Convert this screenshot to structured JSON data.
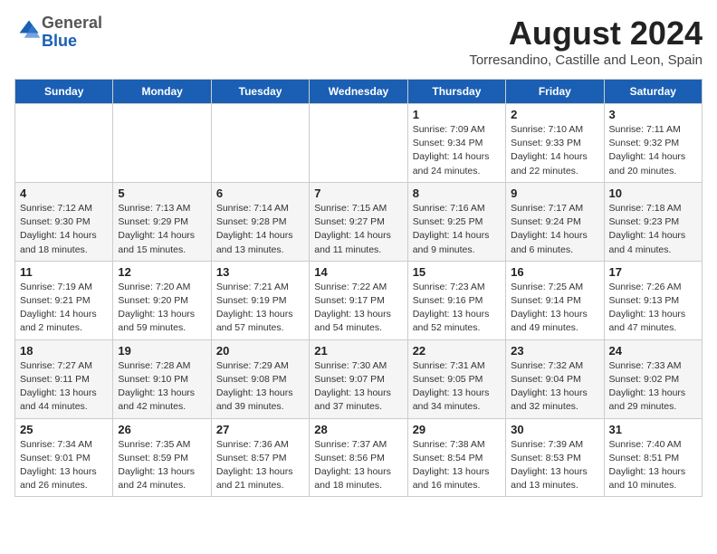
{
  "header": {
    "logo_line1": "General",
    "logo_line2": "Blue",
    "month_title": "August 2024",
    "location": "Torresandino, Castille and Leon, Spain"
  },
  "weekdays": [
    "Sunday",
    "Monday",
    "Tuesday",
    "Wednesday",
    "Thursday",
    "Friday",
    "Saturday"
  ],
  "weeks": [
    [
      {
        "day": "",
        "info": ""
      },
      {
        "day": "",
        "info": ""
      },
      {
        "day": "",
        "info": ""
      },
      {
        "day": "",
        "info": ""
      },
      {
        "day": "1",
        "info": "Sunrise: 7:09 AM\nSunset: 9:34 PM\nDaylight: 14 hours and 24 minutes."
      },
      {
        "day": "2",
        "info": "Sunrise: 7:10 AM\nSunset: 9:33 PM\nDaylight: 14 hours and 22 minutes."
      },
      {
        "day": "3",
        "info": "Sunrise: 7:11 AM\nSunset: 9:32 PM\nDaylight: 14 hours and 20 minutes."
      }
    ],
    [
      {
        "day": "4",
        "info": "Sunrise: 7:12 AM\nSunset: 9:30 PM\nDaylight: 14 hours and 18 minutes."
      },
      {
        "day": "5",
        "info": "Sunrise: 7:13 AM\nSunset: 9:29 PM\nDaylight: 14 hours and 15 minutes."
      },
      {
        "day": "6",
        "info": "Sunrise: 7:14 AM\nSunset: 9:28 PM\nDaylight: 14 hours and 13 minutes."
      },
      {
        "day": "7",
        "info": "Sunrise: 7:15 AM\nSunset: 9:27 PM\nDaylight: 14 hours and 11 minutes."
      },
      {
        "day": "8",
        "info": "Sunrise: 7:16 AM\nSunset: 9:25 PM\nDaylight: 14 hours and 9 minutes."
      },
      {
        "day": "9",
        "info": "Sunrise: 7:17 AM\nSunset: 9:24 PM\nDaylight: 14 hours and 6 minutes."
      },
      {
        "day": "10",
        "info": "Sunrise: 7:18 AM\nSunset: 9:23 PM\nDaylight: 14 hours and 4 minutes."
      }
    ],
    [
      {
        "day": "11",
        "info": "Sunrise: 7:19 AM\nSunset: 9:21 PM\nDaylight: 14 hours and 2 minutes."
      },
      {
        "day": "12",
        "info": "Sunrise: 7:20 AM\nSunset: 9:20 PM\nDaylight: 13 hours and 59 minutes."
      },
      {
        "day": "13",
        "info": "Sunrise: 7:21 AM\nSunset: 9:19 PM\nDaylight: 13 hours and 57 minutes."
      },
      {
        "day": "14",
        "info": "Sunrise: 7:22 AM\nSunset: 9:17 PM\nDaylight: 13 hours and 54 minutes."
      },
      {
        "day": "15",
        "info": "Sunrise: 7:23 AM\nSunset: 9:16 PM\nDaylight: 13 hours and 52 minutes."
      },
      {
        "day": "16",
        "info": "Sunrise: 7:25 AM\nSunset: 9:14 PM\nDaylight: 13 hours and 49 minutes."
      },
      {
        "day": "17",
        "info": "Sunrise: 7:26 AM\nSunset: 9:13 PM\nDaylight: 13 hours and 47 minutes."
      }
    ],
    [
      {
        "day": "18",
        "info": "Sunrise: 7:27 AM\nSunset: 9:11 PM\nDaylight: 13 hours and 44 minutes."
      },
      {
        "day": "19",
        "info": "Sunrise: 7:28 AM\nSunset: 9:10 PM\nDaylight: 13 hours and 42 minutes."
      },
      {
        "day": "20",
        "info": "Sunrise: 7:29 AM\nSunset: 9:08 PM\nDaylight: 13 hours and 39 minutes."
      },
      {
        "day": "21",
        "info": "Sunrise: 7:30 AM\nSunset: 9:07 PM\nDaylight: 13 hours and 37 minutes."
      },
      {
        "day": "22",
        "info": "Sunrise: 7:31 AM\nSunset: 9:05 PM\nDaylight: 13 hours and 34 minutes."
      },
      {
        "day": "23",
        "info": "Sunrise: 7:32 AM\nSunset: 9:04 PM\nDaylight: 13 hours and 32 minutes."
      },
      {
        "day": "24",
        "info": "Sunrise: 7:33 AM\nSunset: 9:02 PM\nDaylight: 13 hours and 29 minutes."
      }
    ],
    [
      {
        "day": "25",
        "info": "Sunrise: 7:34 AM\nSunset: 9:01 PM\nDaylight: 13 hours and 26 minutes."
      },
      {
        "day": "26",
        "info": "Sunrise: 7:35 AM\nSunset: 8:59 PM\nDaylight: 13 hours and 24 minutes."
      },
      {
        "day": "27",
        "info": "Sunrise: 7:36 AM\nSunset: 8:57 PM\nDaylight: 13 hours and 21 minutes."
      },
      {
        "day": "28",
        "info": "Sunrise: 7:37 AM\nSunset: 8:56 PM\nDaylight: 13 hours and 18 minutes."
      },
      {
        "day": "29",
        "info": "Sunrise: 7:38 AM\nSunset: 8:54 PM\nDaylight: 13 hours and 16 minutes."
      },
      {
        "day": "30",
        "info": "Sunrise: 7:39 AM\nSunset: 8:53 PM\nDaylight: 13 hours and 13 minutes."
      },
      {
        "day": "31",
        "info": "Sunrise: 7:40 AM\nSunset: 8:51 PM\nDaylight: 13 hours and 10 minutes."
      }
    ]
  ]
}
